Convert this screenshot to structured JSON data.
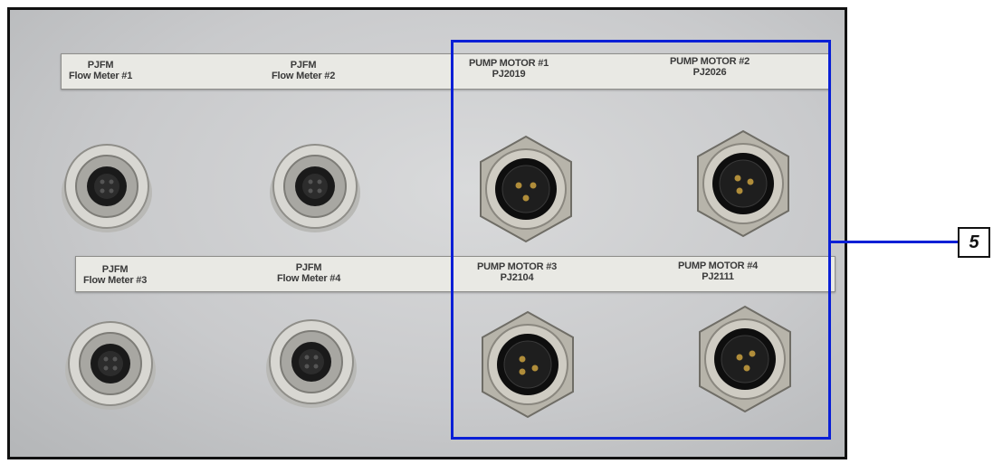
{
  "top_row_labels": [
    {
      "line1": "PJFM",
      "line2": "Flow Meter #1"
    },
    {
      "line1": "PJFM",
      "line2": "Flow Meter #2"
    },
    {
      "line1": "PUMP MOTOR #1",
      "line2": "PJ2019"
    },
    {
      "line1": "PUMP MOTOR #2",
      "line2": "PJ2026"
    }
  ],
  "bottom_row_labels": [
    {
      "line1": "PJFM",
      "line2": "Flow Meter #3"
    },
    {
      "line1": "PJFM",
      "line2": "Flow Meter #4"
    },
    {
      "line1": "PUMP MOTOR #3",
      "line2": "PJ2104"
    },
    {
      "line1": "PUMP MOTOR #4",
      "line2": "PJ2111"
    }
  ],
  "callout": {
    "number": "5",
    "color": "#0a1fd6"
  },
  "colors": {
    "panel": "#cfd0d2",
    "label_strip": "#e9e9e4",
    "metal": "#a9a8a2",
    "socket": "#151515"
  }
}
